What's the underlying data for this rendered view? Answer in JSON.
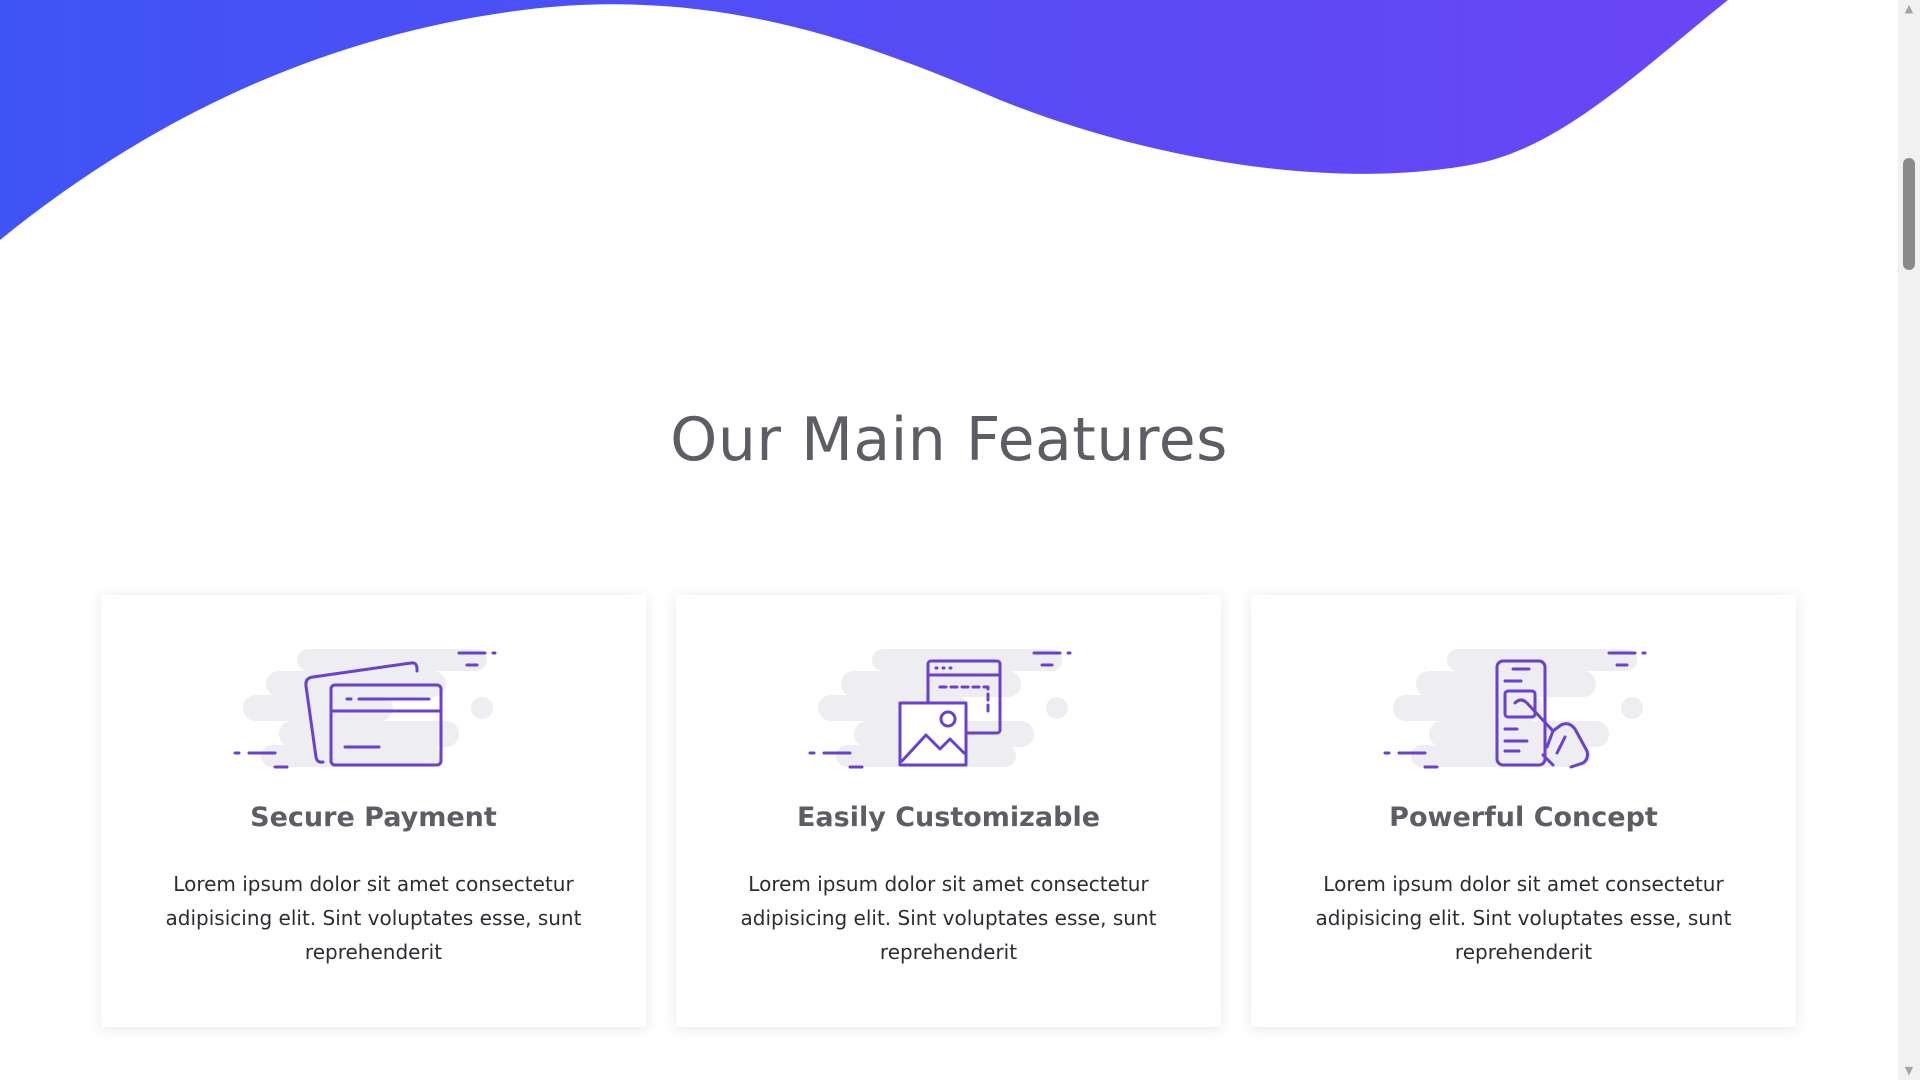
{
  "colors": {
    "gradient_start": "#3f54f5",
    "gradient_end": "#6a45f6",
    "icon_purple": "#6a3fd1",
    "icon_cloud": "#eeedf2",
    "title_gray": "#5f5c66",
    "text_dark": "#2e2c33"
  },
  "section": {
    "title": "Our Main Features"
  },
  "features": [
    {
      "icon": "credit-card-icon",
      "title": "Secure Payment",
      "text": "Lorem ipsum dolor sit amet consectetur adipisicing elit. Sint voluptates esse, sunt reprehenderit"
    },
    {
      "icon": "image-window-icon",
      "title": "Easily Customizable",
      "text": "Lorem ipsum dolor sit amet consectetur adipisicing elit. Sint voluptates esse, sunt reprehenderit"
    },
    {
      "icon": "phone-touch-icon",
      "title": "Powerful Concept",
      "text": "Lorem ipsum dolor sit amet consectetur adipisicing elit. Sint voluptates esse, sunt reprehenderit"
    }
  ],
  "scrollbar": {
    "up_arrow": "▲",
    "down_arrow": "▼"
  }
}
